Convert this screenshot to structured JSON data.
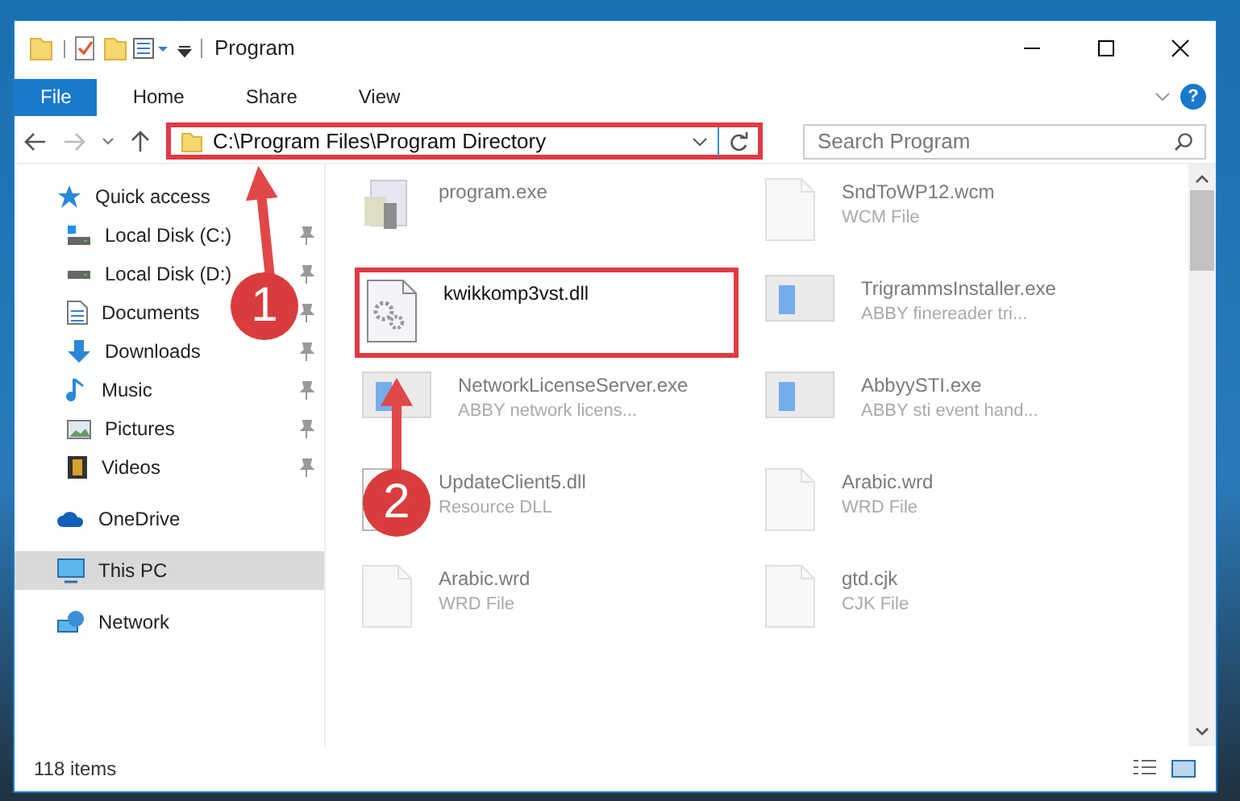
{
  "window": {
    "title": "Program"
  },
  "ribbon_tabs": [
    {
      "label": "File",
      "selected": true
    },
    {
      "label": "Home",
      "selected": false
    },
    {
      "label": "Share",
      "selected": false
    },
    {
      "label": "View",
      "selected": false
    }
  ],
  "help_button": {
    "label": "?"
  },
  "address_bar": {
    "path": "C:\\Program Files\\Program Directory",
    "highlighted": true
  },
  "search": {
    "placeholder": "Search Program"
  },
  "sidebar": {
    "items": [
      {
        "label": "Quick access",
        "kind": "star",
        "selected": false,
        "children": [
          {
            "label": "Local Disk (C:)",
            "kind": "system-disk",
            "selected": false,
            "pinned": true
          },
          {
            "label": "Local Disk (D:)",
            "kind": "disk",
            "selected": false,
            "pinned": true
          },
          {
            "label": "Documents",
            "kind": "documents",
            "selected": false,
            "pinned": true
          },
          {
            "label": "Downloads",
            "kind": "downloads",
            "selected": false,
            "pinned": true
          },
          {
            "label": "Music",
            "kind": "music",
            "selected": false,
            "pinned": true
          },
          {
            "label": "Pictures",
            "kind": "pictures",
            "selected": false,
            "pinned": true
          },
          {
            "label": "Videos",
            "kind": "videos",
            "selected": false,
            "pinned": true
          }
        ]
      },
      {
        "label": "OneDrive",
        "kind": "cloud",
        "selected": false
      },
      {
        "label": "This PC",
        "kind": "computer",
        "selected": true
      },
      {
        "label": "Network",
        "kind": "network",
        "selected": false
      }
    ]
  },
  "files": [
    {
      "name": "program.exe",
      "kind": "exe",
      "blurred": true,
      "highlighted": false
    },
    {
      "name": "SndToWP12.wcm",
      "type": "WCM File",
      "kind": "file",
      "blurred": true,
      "highlighted": false
    },
    {
      "name": "kwikkomp3vst.dll",
      "kind": "dll",
      "blurred": false,
      "highlighted": true
    },
    {
      "name": "TrigrammsInstaller.exe",
      "type": "ABBY finereader tri...",
      "kind": "app",
      "blurred": true,
      "highlighted": false
    },
    {
      "name": "NetworkLicenseServer.exe",
      "type": "ABBY network licens...",
      "kind": "app",
      "blurred": true,
      "highlighted": false
    },
    {
      "name": "AbbyySTI.exe",
      "type": "ABBY sti event hand...",
      "kind": "app",
      "blurred": true,
      "highlighted": false
    },
    {
      "name": "UpdateClient5.dll",
      "type": "Resource DLL",
      "kind": "dll",
      "blurred": true,
      "highlighted": false
    },
    {
      "name": "Arabic.wrd",
      "type": "WRD File",
      "kind": "file",
      "blurred": true,
      "highlighted": false
    },
    {
      "name": "Arabic.wrd",
      "type": "WRD File",
      "kind": "file",
      "blurred": true,
      "highlighted": false
    },
    {
      "name": "gtd.cjk",
      "type": "CJK File",
      "kind": "file",
      "blurred": true,
      "highlighted": false
    }
  ],
  "status_bar": {
    "count": "118 items"
  },
  "annotations": [
    {
      "number": "1"
    },
    {
      "number": "2"
    }
  ]
}
